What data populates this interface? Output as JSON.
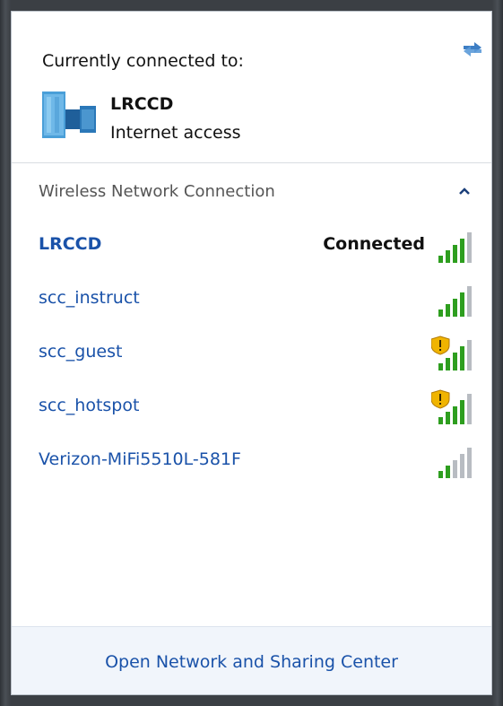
{
  "header": {
    "current_label": "Currently connected to:",
    "network_name": "LRCCD",
    "network_status": "Internet access"
  },
  "section": {
    "title": "Wireless Network Connection"
  },
  "networks": [
    {
      "name": "LRCCD",
      "status": "Connected",
      "secured_warning": false,
      "bars": 4
    },
    {
      "name": "scc_instruct",
      "status": "",
      "secured_warning": false,
      "bars": 4
    },
    {
      "name": "scc_guest",
      "status": "",
      "secured_warning": true,
      "bars": 4
    },
    {
      "name": "scc_hotspot",
      "status": "",
      "secured_warning": true,
      "bars": 4
    },
    {
      "name": "Verizon-MiFi5510L-581F",
      "status": "",
      "secured_warning": false,
      "bars": 2
    }
  ],
  "footer": {
    "link_label": "Open Network and Sharing Center"
  },
  "colors": {
    "link": "#1a52a9",
    "signal_on": "#2e9e1f",
    "signal_off": "#b8bcc2",
    "warning": "#f0b400"
  }
}
